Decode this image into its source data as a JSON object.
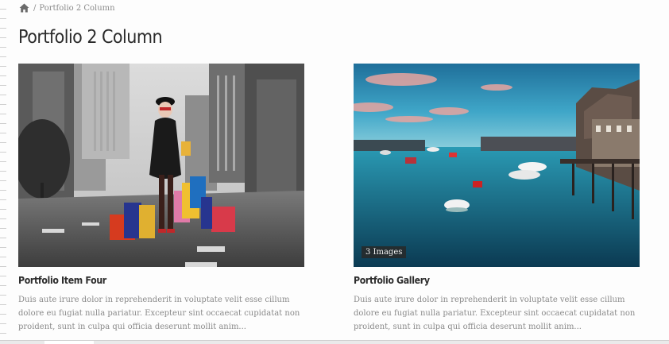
{
  "breadcrumb": {
    "separator": "/",
    "current": "Portfolio 2 Column"
  },
  "page": {
    "title": "Portfolio 2 Column"
  },
  "items": [
    {
      "title": "Portfolio Item Four",
      "excerpt": "Duis aute irure dolor in reprehenderit in voluptate velit esse cillum dolore eu fugiat nulla pariatur. Excepteur sint occaecat cupidatat non proident, sunt in culpa qui officia deserunt mollit anim..."
    },
    {
      "title": "Portfolio Gallery",
      "badge": "3 Images",
      "excerpt": "Duis aute irure dolor in reprehenderit in voluptate velit esse cillum dolore eu fugiat nulla pariatur. Excepteur sint occaecat cupidatat non proident, sunt in culpa qui officia deserunt mollit anim..."
    }
  ],
  "icons": {
    "home": "home-icon"
  },
  "colors": {
    "title": "#2a2a2a",
    "muted": "#8a8a8a",
    "badge_bg": "#2b2b2b"
  }
}
